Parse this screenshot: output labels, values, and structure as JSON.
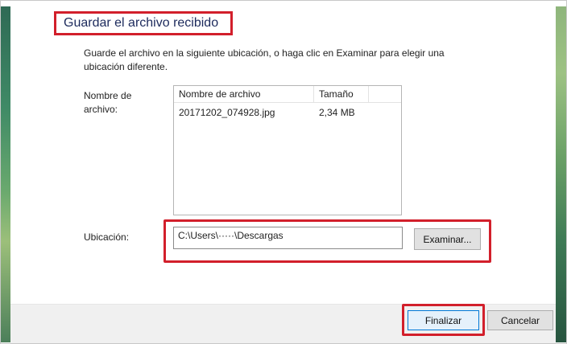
{
  "dialog": {
    "title": "Guardar el archivo recibido",
    "description": "Guarde el archivo en la siguiente ubicación, o haga clic en Examinar para elegir una ubicación diferente."
  },
  "file_list": {
    "label": "Nombre de archivo:",
    "columns": [
      "Nombre de archivo",
      "Tamaño"
    ],
    "rows": [
      {
        "name": "20171202_074928.jpg",
        "size": "2,34 MB"
      }
    ]
  },
  "location": {
    "label": "Ubicación:",
    "value": "C:\\Users\\·····\\Descargas",
    "browse_label": "Examinar..."
  },
  "footer": {
    "finish_label": "Finalizar",
    "cancel_label": "Cancelar"
  },
  "colors": {
    "highlight": "#d21f2b",
    "title_text": "#1c2a5c",
    "footer_bg": "#f0f0f0",
    "default_button_border": "#0078d7"
  }
}
